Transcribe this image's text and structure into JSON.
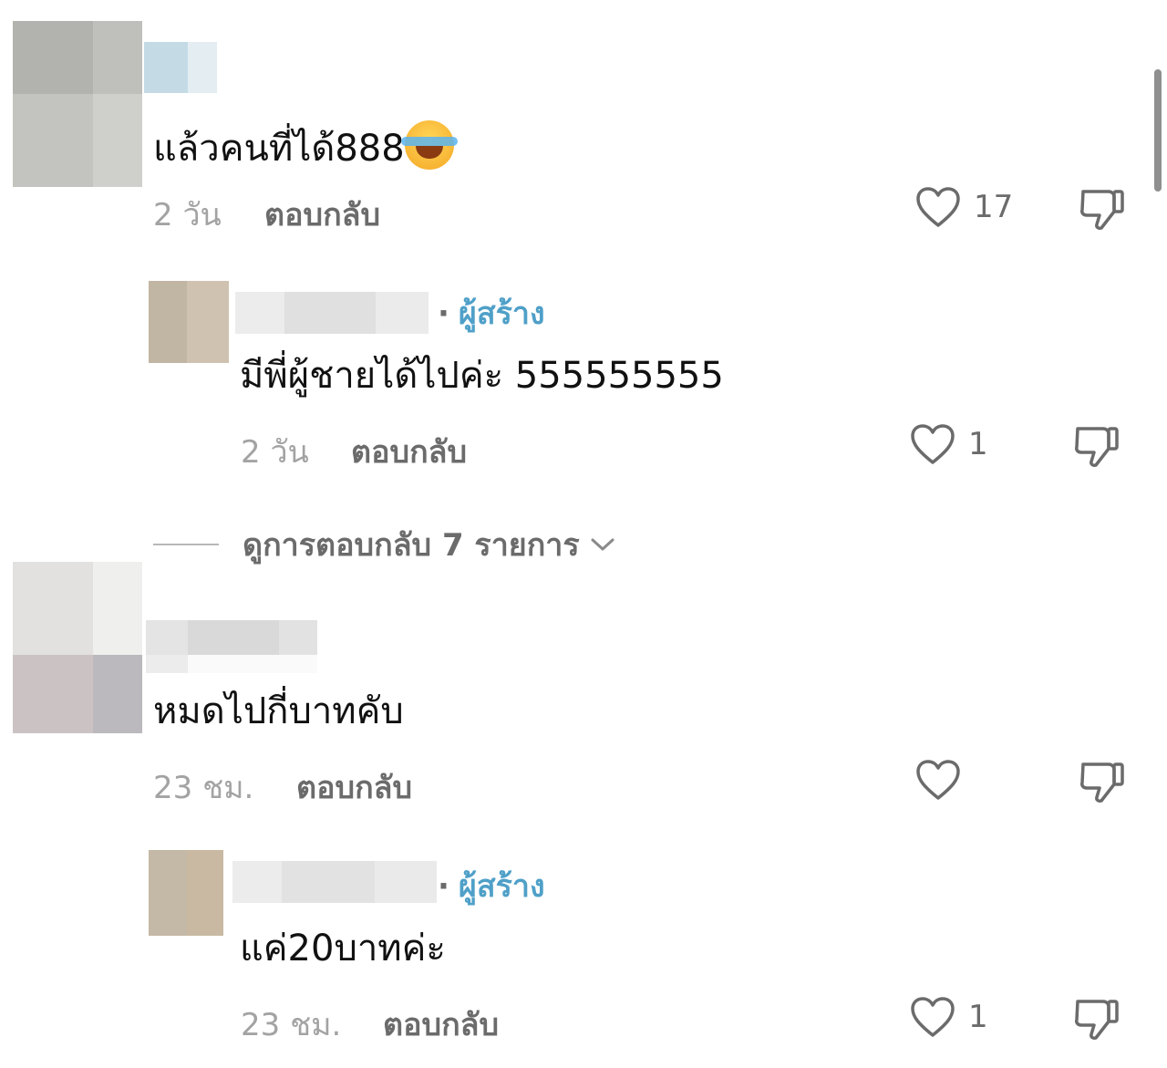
{
  "comments": [
    {
      "text": "แล้วคนที่ได้888",
      "emoji": "tears-of-joy-emoji",
      "time": "2 วัน",
      "reply_label": "ตอบกลับ",
      "likes": "17"
    },
    {
      "creator_dot": "·",
      "creator_label": "ผู้สร้าง",
      "text": "มีพี่ผู้ชายได้ไปค่ะ 555555555",
      "time": "2 วัน",
      "reply_label": "ตอบกลับ",
      "likes": "1"
    },
    {
      "text": "หมดไปกี่บาทคับ",
      "time": "23 ชม.",
      "reply_label": "ตอบกลับ",
      "likes": ""
    },
    {
      "creator_dot": "·",
      "creator_label": "ผู้สร้าง",
      "text": "แค่20บาทค่ะ",
      "time": "23 ชม.",
      "reply_label": "ตอบกลับ",
      "likes": "1"
    }
  ],
  "view_replies": {
    "label": "ดูการตอบกลับ 7 รายการ"
  },
  "icons": {
    "heart": "heart-icon",
    "dislike": "thumbs-down-icon",
    "chevron": "chevron-down-icon"
  },
  "colors": {
    "creator_badge": "#4fa0c8",
    "muted_text": "#a3a3a3",
    "secondary_text": "#6b6b6b"
  }
}
